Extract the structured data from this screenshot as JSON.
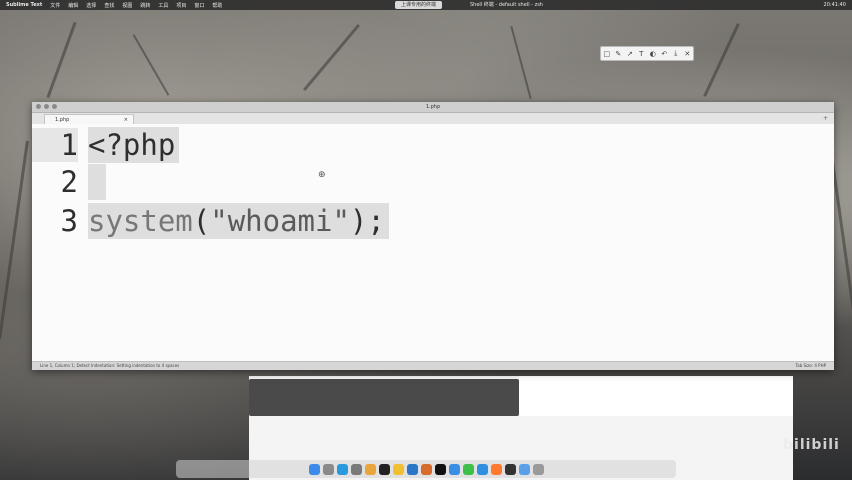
{
  "menubar": {
    "app_name": "Sublime Text",
    "items": [
      "文件",
      "编辑",
      "选择",
      "查找",
      "视图",
      "跳转",
      "工具",
      "项目",
      "窗口",
      "帮助"
    ],
    "center_label": "上课专用的终端 ",
    "center_label2": "Shell 终端 - default shell - zsh",
    "clock": "20:41:40"
  },
  "annotation_toolbar": {
    "icons": [
      "rect-icon",
      "pen-icon",
      "arrow-icon",
      "text-icon",
      "mosaic-icon",
      "undo-icon",
      "save-icon",
      "close-icon"
    ],
    "glyphs": [
      "□",
      "✎",
      "↗",
      "T",
      "◐",
      "↶",
      "⤓",
      "✕"
    ]
  },
  "window": {
    "title": "1.php",
    "tab_label": "1.php",
    "tab_close": "×",
    "new_tab": "+"
  },
  "editor": {
    "lines": [
      {
        "num": "1",
        "text": "<?php"
      },
      {
        "num": "2",
        "text": ""
      },
      {
        "num": "3",
        "fn": "system",
        "open": "(",
        "str": "\"whoami\"",
        "close": ");"
      }
    ]
  },
  "statusbar": {
    "left": "Line 1, Column 1; Detect Indentation: Setting indentation to 4 spaces",
    "right": "Tab Size: 4    PHP"
  },
  "watermark": "bilibili",
  "dock": {
    "icons": [
      "finder-icon",
      "launchpad-icon",
      "safari-icon",
      "settings-icon",
      "chrome-icon",
      "terminal-icon",
      "notes-icon",
      "vscode-icon",
      "burp-icon",
      "x-icon",
      "folder-icon",
      "wechat-icon",
      "qq-icon",
      "sublime-icon",
      "typora-icon",
      "preview-icon",
      "trash-icon"
    ],
    "colors": [
      "#3d8be8",
      "#8a8a8a",
      "#2a9ae0",
      "#7a7a7a",
      "#e9a53a",
      "#222222",
      "#f0c030",
      "#2a77c8",
      "#d86b2e",
      "#111111",
      "#3a8ee6",
      "#3ebf4a",
      "#2f8fe0",
      "#ff7a2f",
      "#333333",
      "#5aa0e8",
      "#9a9a9a"
    ]
  }
}
